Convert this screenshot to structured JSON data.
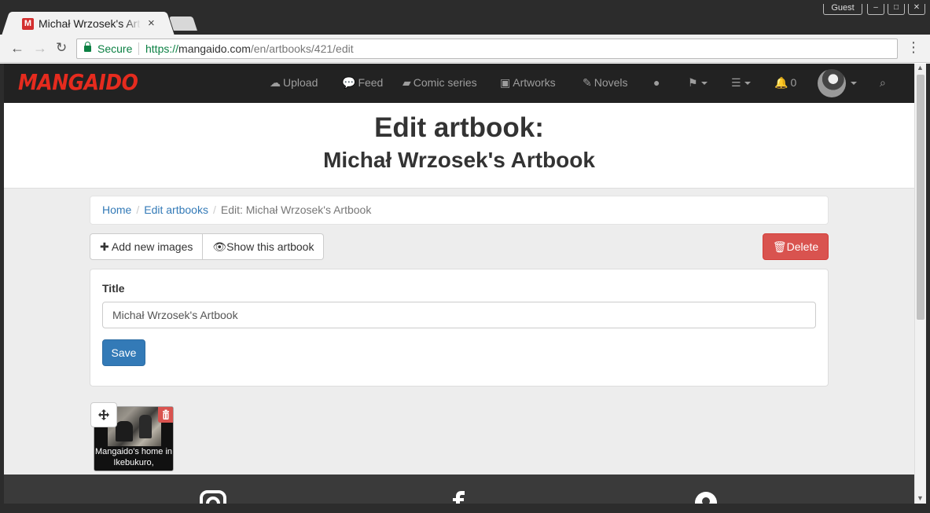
{
  "browser": {
    "window_controls": {
      "guest_label": "Guest"
    },
    "tab": {
      "favicon_letter": "M",
      "title": "Michał Wrzosek's Artbook - Mangaido",
      "close": "×"
    },
    "address_bar": {
      "secure_label": "Secure",
      "url_scheme": "https://",
      "url_host": "mangaido.com",
      "url_path": "/en/artbooks/421/edit"
    }
  },
  "navbar": {
    "logo": "MANGAIDO",
    "items": [
      {
        "label": "Upload",
        "icon": "cloud-upload-icon"
      },
      {
        "label": "Feed",
        "icon": "comments-icon"
      },
      {
        "label": "Comic series",
        "icon": "book-icon"
      },
      {
        "label": "Artworks",
        "icon": "picture-icon"
      },
      {
        "label": "Novels",
        "icon": "edit-icon"
      }
    ],
    "notification_count": "0",
    "brand_color": "#e52b1e"
  },
  "header": {
    "title": "Edit artbook:",
    "subtitle": "Michał Wrzosek's Artbook"
  },
  "breadcrumb": {
    "items": [
      {
        "label": "Home"
      },
      {
        "label": "Edit artbooks"
      },
      {
        "label": "Edit: Michał Wrzosek's Artbook"
      }
    ]
  },
  "actions": {
    "add_images": "Add new images",
    "show_artbook": "Show this artbook",
    "delete": "Delete"
  },
  "form": {
    "title_label": "Title",
    "title_value": "Michał Wrzosek's Artbook",
    "save": "Save"
  },
  "images": [
    {
      "caption": "Mangaido's home in Ikebukuro,"
    }
  ],
  "colors": {
    "primary": "#337ab7",
    "danger": "#d9534f",
    "navbar_bg": "#222222"
  }
}
